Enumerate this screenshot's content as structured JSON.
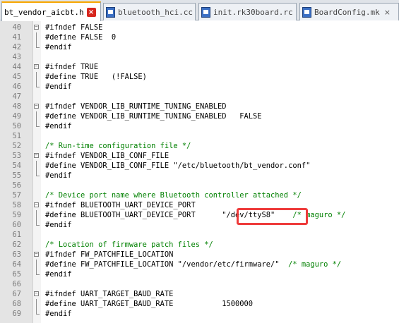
{
  "tabs": [
    {
      "label": "bt_vendor_aicbt.h",
      "active": true
    },
    {
      "label": "bluetooth_hci.cc",
      "active": false
    },
    {
      "label": "init.rk30board.rc",
      "active": false
    },
    {
      "label": "BoardConfig.mk",
      "active": false
    }
  ],
  "highlight_color": "#ee3b3b",
  "lines": [
    {
      "n": "40",
      "parts": [
        {
          "t": "#ifndef FALSE",
          "c": "kw"
        }
      ],
      "fold": "start"
    },
    {
      "n": "41",
      "parts": [
        {
          "t": "#define FALSE  0",
          "c": "kw"
        }
      ],
      "fold": "mid"
    },
    {
      "n": "42",
      "parts": [
        {
          "t": "#endif",
          "c": "kw"
        }
      ],
      "fold": "end"
    },
    {
      "n": "43",
      "parts": [],
      "fold": ""
    },
    {
      "n": "44",
      "parts": [
        {
          "t": "#ifndef TRUE",
          "c": "kw"
        }
      ],
      "fold": "start"
    },
    {
      "n": "45",
      "parts": [
        {
          "t": "#define TRUE   (!FALSE)",
          "c": "kw"
        }
      ],
      "fold": "mid"
    },
    {
      "n": "46",
      "parts": [
        {
          "t": "#endif",
          "c": "kw"
        }
      ],
      "fold": "end"
    },
    {
      "n": "47",
      "parts": [],
      "fold": ""
    },
    {
      "n": "48",
      "parts": [
        {
          "t": "#ifndef VENDOR_LIB_RUNTIME_TUNING_ENABLED",
          "c": "kw"
        }
      ],
      "fold": "start"
    },
    {
      "n": "49",
      "parts": [
        {
          "t": "#define VENDOR_LIB_RUNTIME_TUNING_ENABLED   FALSE",
          "c": "kw"
        }
      ],
      "fold": "mid"
    },
    {
      "n": "50",
      "parts": [
        {
          "t": "#endif",
          "c": "kw"
        }
      ],
      "fold": "end"
    },
    {
      "n": "51",
      "parts": [],
      "fold": ""
    },
    {
      "n": "52",
      "parts": [
        {
          "t": "/* Run-time configuration file */",
          "c": "cm"
        }
      ],
      "fold": ""
    },
    {
      "n": "53",
      "parts": [
        {
          "t": "#ifndef VENDOR_LIB_CONF_FILE",
          "c": "kw"
        }
      ],
      "fold": "start"
    },
    {
      "n": "54",
      "parts": [
        {
          "t": "#define VENDOR_LIB_CONF_FILE \"/etc/bluetooth/bt_vendor.conf\"",
          "c": "kw"
        }
      ],
      "fold": "mid"
    },
    {
      "n": "55",
      "parts": [
        {
          "t": "#endif",
          "c": "kw"
        }
      ],
      "fold": "end"
    },
    {
      "n": "56",
      "parts": [],
      "fold": ""
    },
    {
      "n": "57",
      "parts": [
        {
          "t": "/* Device port name where Bluetooth controller attached */",
          "c": "cm"
        }
      ],
      "fold": ""
    },
    {
      "n": "58",
      "parts": [
        {
          "t": "#ifndef BLUETOOTH_UART_DEVICE_PORT",
          "c": "kw"
        }
      ],
      "fold": "start"
    },
    {
      "n": "59",
      "parts": [
        {
          "t": "#define BLUETOOTH_UART_DEVICE_PORT      \"/dev/ttyS8\"    ",
          "c": "kw"
        },
        {
          "t": "/* maguro */",
          "c": "cm"
        }
      ],
      "fold": "mid"
    },
    {
      "n": "60",
      "parts": [
        {
          "t": "#endif",
          "c": "kw"
        }
      ],
      "fold": "end"
    },
    {
      "n": "61",
      "parts": [],
      "fold": ""
    },
    {
      "n": "62",
      "parts": [
        {
          "t": "/* Location of firmware patch files */",
          "c": "cm"
        }
      ],
      "fold": ""
    },
    {
      "n": "63",
      "parts": [
        {
          "t": "#ifndef FW_PATCHFILE_LOCATION",
          "c": "kw"
        }
      ],
      "fold": "start"
    },
    {
      "n": "64",
      "parts": [
        {
          "t": "#define FW_PATCHFILE_LOCATION \"/vendor/etc/firmware/\"  ",
          "c": "kw"
        },
        {
          "t": "/* maguro */",
          "c": "cm"
        }
      ],
      "fold": "mid"
    },
    {
      "n": "65",
      "parts": [
        {
          "t": "#endif",
          "c": "kw"
        }
      ],
      "fold": "end"
    },
    {
      "n": "66",
      "parts": [],
      "fold": ""
    },
    {
      "n": "67",
      "parts": [
        {
          "t": "#ifndef UART_TARGET_BAUD_RATE",
          "c": "kw"
        }
      ],
      "fold": "start"
    },
    {
      "n": "68",
      "parts": [
        {
          "t": "#define UART_TARGET_BAUD_RATE           1500000",
          "c": "kw"
        }
      ],
      "fold": "mid"
    },
    {
      "n": "69",
      "parts": [
        {
          "t": "#endif",
          "c": "kw"
        }
      ],
      "fold": "end"
    }
  ]
}
